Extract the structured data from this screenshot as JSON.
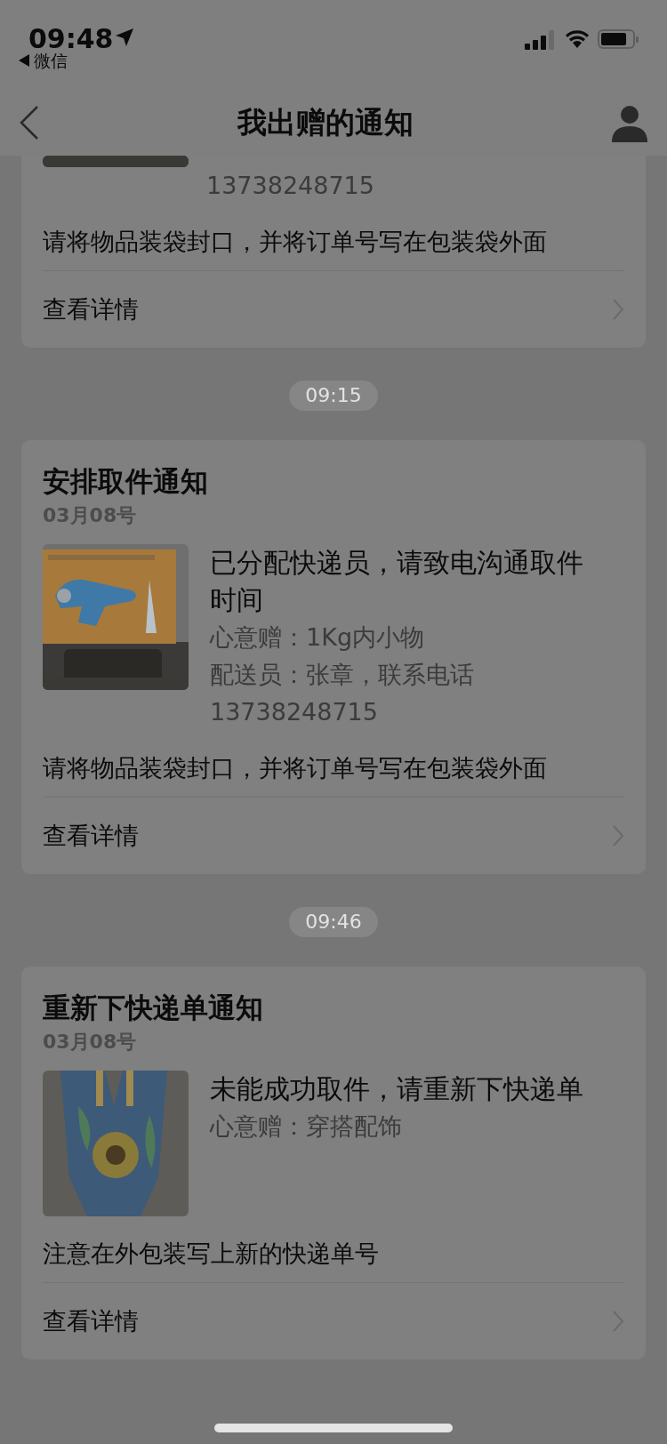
{
  "status_bar": {
    "time": "09:48",
    "back_app": "微信"
  },
  "nav": {
    "title": "我出赠的通知"
  },
  "feed": [
    {
      "kind": "clipped",
      "image": {
        "kind": "picture"
      },
      "lines": [
        "13738248715"
      ],
      "note": "请将物品装袋封口，并将订单号写在包装袋外面",
      "action": "查看详情"
    },
    {
      "kind": "time",
      "text": "09:15"
    },
    {
      "kind": "card",
      "title": "安排取件通知",
      "date": "03月08号",
      "image": {
        "kind": "picture"
      },
      "headline": "已分配快递员，请致电沟通取件时间",
      "lines": [
        "心意赠：1Kg内小物",
        "配送员：张章，联系电话13738248715"
      ],
      "note": "请将物品装袋封口，并将订单号写在包装袋外面",
      "action": "查看详情"
    },
    {
      "kind": "time",
      "text": "09:46"
    },
    {
      "kind": "card",
      "title": "重新下快递单通知",
      "date": "03月08号",
      "image": {
        "kind": "picture"
      },
      "headline": "未能成功取件，请重新下快递单",
      "lines": [
        "心意赠：穿搭配饰"
      ],
      "note": "注意在外包装写上新的快递单号",
      "action": "查看详情"
    }
  ]
}
